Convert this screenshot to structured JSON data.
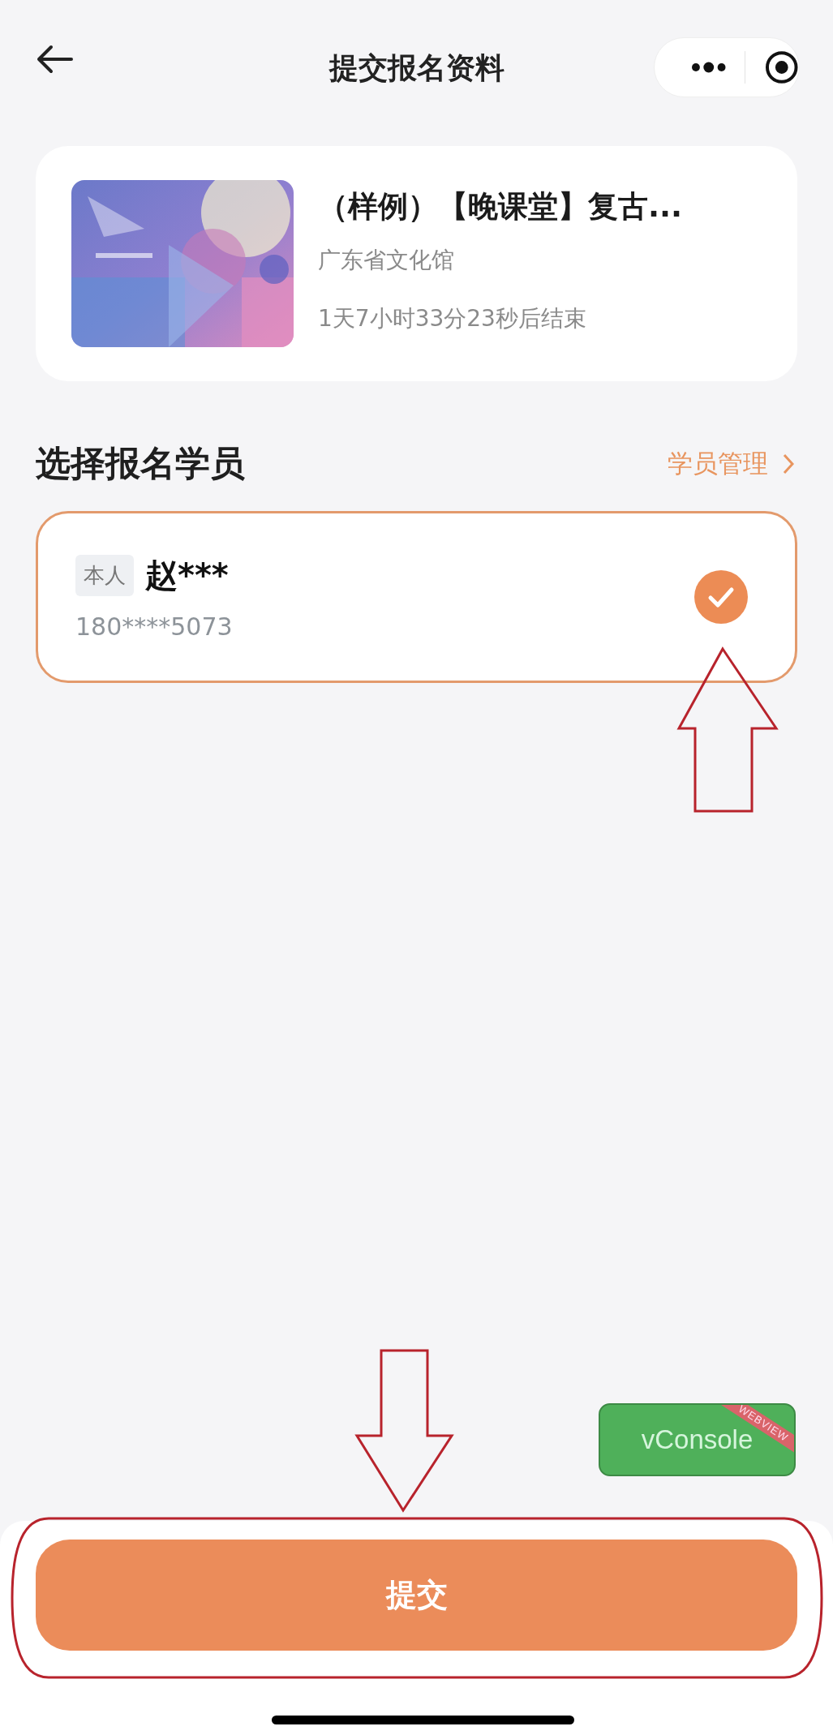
{
  "header": {
    "title": "提交报名资料"
  },
  "activity": {
    "title": "（样例）【晚课堂】复古...",
    "organizer": "广东省文化馆",
    "countdown": "1天7小时33分23秒后结束"
  },
  "section": {
    "title": "选择报名学员",
    "link": "学员管理"
  },
  "students": [
    {
      "tag": "本人",
      "name": "赵***",
      "phone": "180****5073",
      "selected": true
    }
  ],
  "vconsole": {
    "label": "vConsole",
    "ribbon": "WEBVIEW"
  },
  "submit": {
    "label": "提交"
  }
}
